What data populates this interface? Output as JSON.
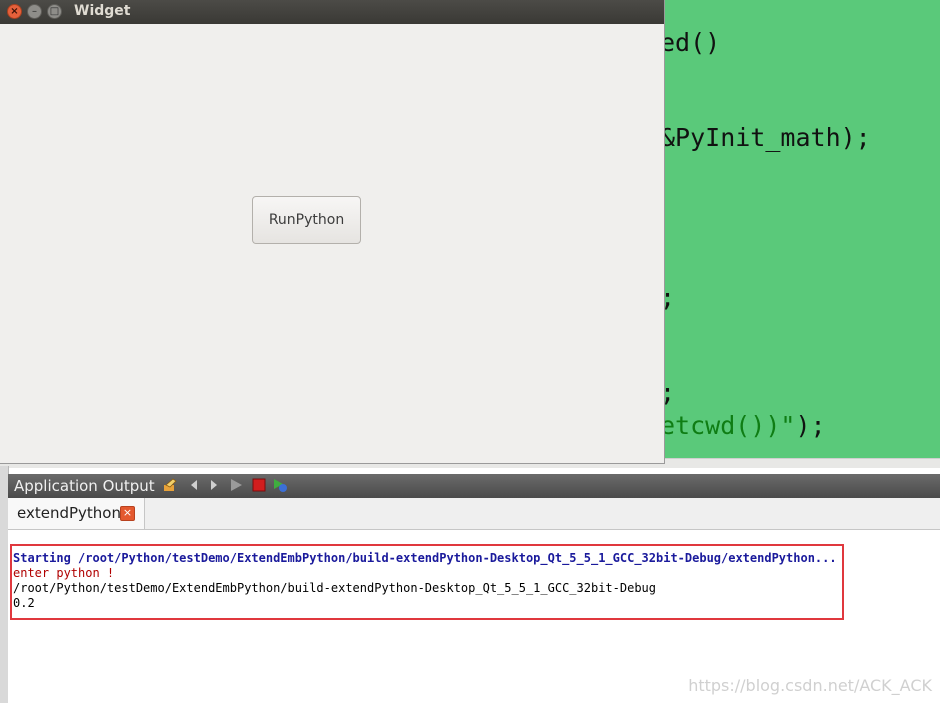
{
  "editor": {
    "lines": [
      {
        "text": "ed()"
      },
      {
        "text": "&PyInit_math);"
      },
      {
        "text": ";"
      },
      {
        "text": ";"
      },
      {
        "text_str": "etcwd())\"",
        "text_tail": ");"
      }
    ]
  },
  "window": {
    "title": "Widget",
    "close_glyph": "×",
    "min_glyph": "–",
    "max_glyph": "□",
    "run_button_label": "RunPython"
  },
  "output": {
    "pane_title": "Application Output",
    "tab_label": "extendPython",
    "tab_close_glyph": "×",
    "toolbar_icons": [
      "clear-output-icon",
      "previous-icon",
      "next-icon",
      "run-icon",
      "stop-icon",
      "attach-debugger-icon"
    ],
    "lines": [
      {
        "text": "Starting /root/Python/testDemo/ExtendEmbPython/build-extendPython-Desktop_Qt_5_5_1_GCC_32bit-Debug/extendPython..."
      },
      {
        "text": "enter python !"
      },
      {
        "text": "/root/Python/testDemo/ExtendEmbPython/build-extendPython-Desktop_Qt_5_5_1_GCC_32bit-Debug"
      },
      {
        "text": "0.2"
      }
    ]
  },
  "watermark": "https://blog.csdn.net/ACK_ACK",
  "colors": {
    "editor_bg": "#5ac97a",
    "highlight_border": "#e0383e",
    "starting_text": "#1a1a9c",
    "enter_text": "#b00000"
  }
}
